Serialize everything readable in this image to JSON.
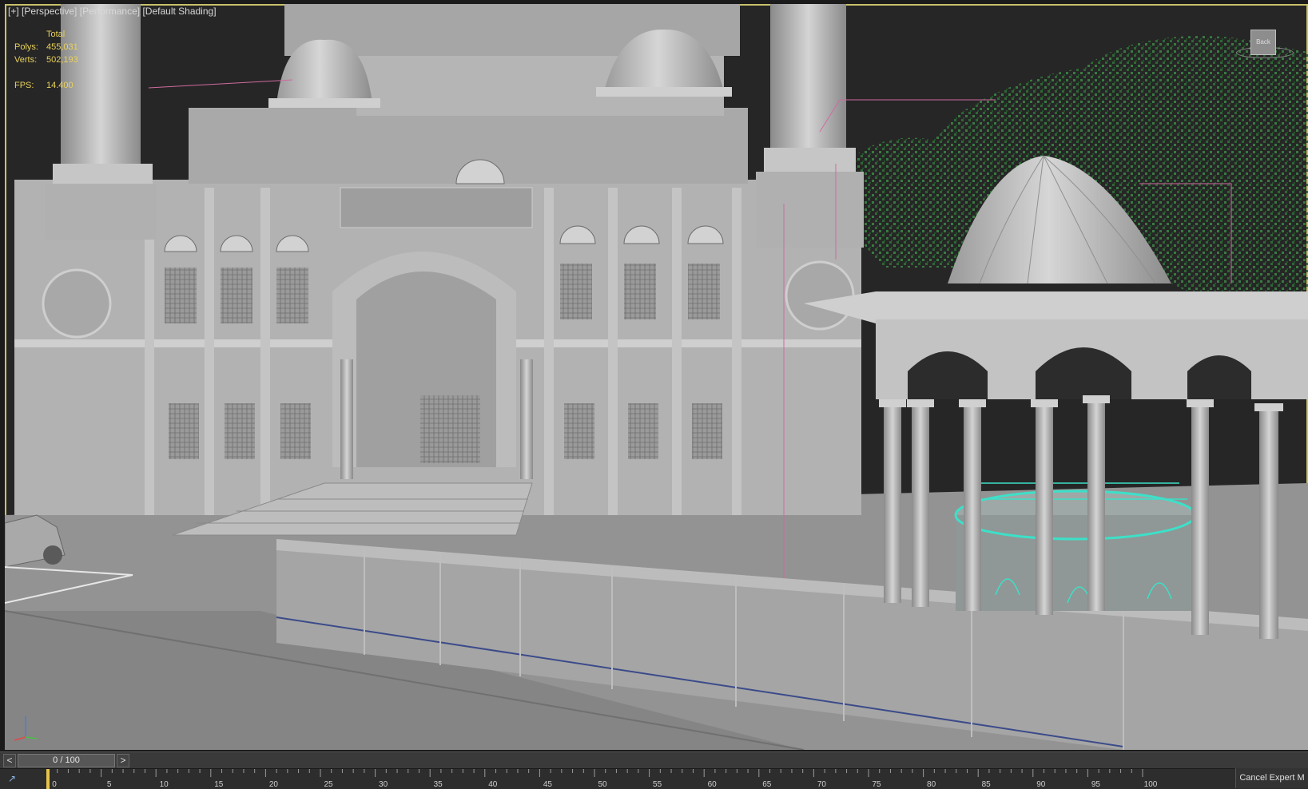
{
  "viewport": {
    "labels": [
      "[+]",
      "[Perspective]",
      "[Performance]",
      "[Default Shading]"
    ],
    "stats": {
      "total_label": "Total",
      "polys_label": "Polys:",
      "polys_value": "455,031",
      "verts_label": "Verts:",
      "verts_value": "502,193",
      "fps_label": "FPS:",
      "fps_value": "14.400"
    },
    "viewcube_label": "Back"
  },
  "timeline": {
    "slider_value": "0 / 100",
    "prev_label": "<",
    "next_label": ">",
    "current_frame": 0,
    "total_frames": 100,
    "ticks": [
      "0",
      "5",
      "10",
      "15",
      "20",
      "25",
      "30",
      "35",
      "40",
      "45",
      "50",
      "55",
      "60",
      "65",
      "70",
      "75",
      "80",
      "85",
      "90",
      "95",
      "100"
    ]
  },
  "cancel_button_label": "Cancel Expert M",
  "colors": {
    "viewport_border": "#c9c06a",
    "stats_text": "#e8d15a",
    "foliage": "#2f6a36",
    "water": "#3de0c8"
  }
}
